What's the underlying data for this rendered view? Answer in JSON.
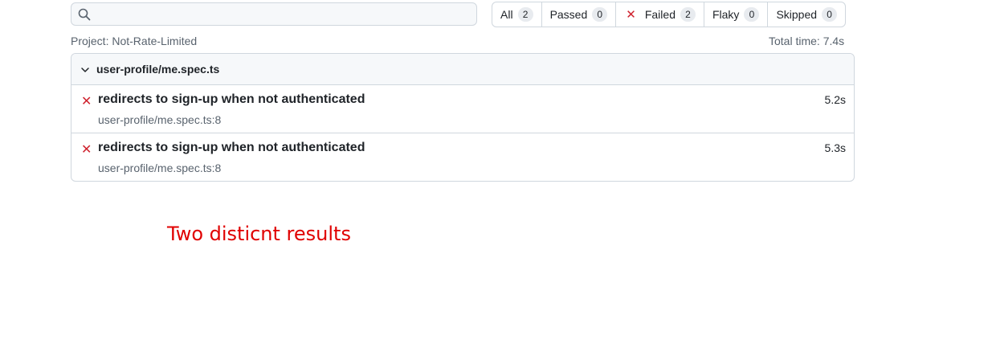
{
  "search": {
    "value": "",
    "placeholder": ""
  },
  "filters": [
    {
      "label": "All",
      "count": "2"
    },
    {
      "label": "Passed",
      "count": "0"
    },
    {
      "label": "Failed",
      "count": "2"
    },
    {
      "label": "Flaky",
      "count": "0"
    },
    {
      "label": "Skipped",
      "count": "0"
    }
  ],
  "meta": {
    "project": "Project: Not-Rate-Limited",
    "total_time": "Total time: 7.4s"
  },
  "file": {
    "name": "user-profile/me.spec.ts",
    "tests": [
      {
        "title": "redirects to sign-up when not authenticated",
        "location": "user-profile/me.spec.ts:8",
        "duration": "5.2s",
        "status": "failed"
      },
      {
        "title": "redirects to sign-up when not authenticated",
        "location": "user-profile/me.spec.ts:8",
        "duration": "5.3s",
        "status": "failed"
      }
    ]
  },
  "annotation": "Two disticnt results",
  "colors": {
    "failed": "#cf222e",
    "annotation": "#e00000",
    "border": "#d0d7de",
    "header_bg": "#f6f8fa"
  },
  "icons": {
    "search": "search-icon",
    "chevron": "chevron-down-icon",
    "failed": "x-icon"
  }
}
